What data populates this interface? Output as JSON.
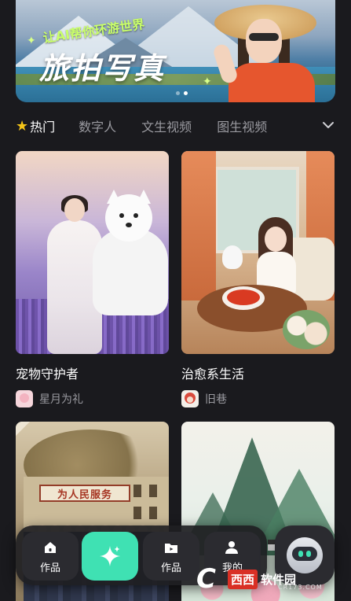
{
  "banner": {
    "subtitle": "让AI帮你环游世界",
    "title": "旅拍写真",
    "page_count": 2,
    "active_page": 2
  },
  "tabs": [
    {
      "label": "热门",
      "active": true,
      "icon": "star-icon"
    },
    {
      "label": "数字人",
      "active": false
    },
    {
      "label": "文生视频",
      "active": false
    },
    {
      "label": "图生视频",
      "active": false
    }
  ],
  "cards": [
    {
      "title": "宠物守护者",
      "author": "星月为礼"
    },
    {
      "title": "治愈系生活",
      "author": "旧巷"
    },
    {
      "sign_text": "为人民服务"
    },
    {}
  ],
  "nav": {
    "item1_label": "作品",
    "item3_label": "作品",
    "item4_label": "我的"
  },
  "watermark": {
    "c": "C",
    "brand1": "西西",
    "brand2": "软件园",
    "url": "CR173.COM"
  },
  "colors": {
    "background": "#1a1a1e",
    "accent": "#3fe1b3",
    "star": "#f5c518",
    "inactive_text": "#9a9aa0"
  }
}
